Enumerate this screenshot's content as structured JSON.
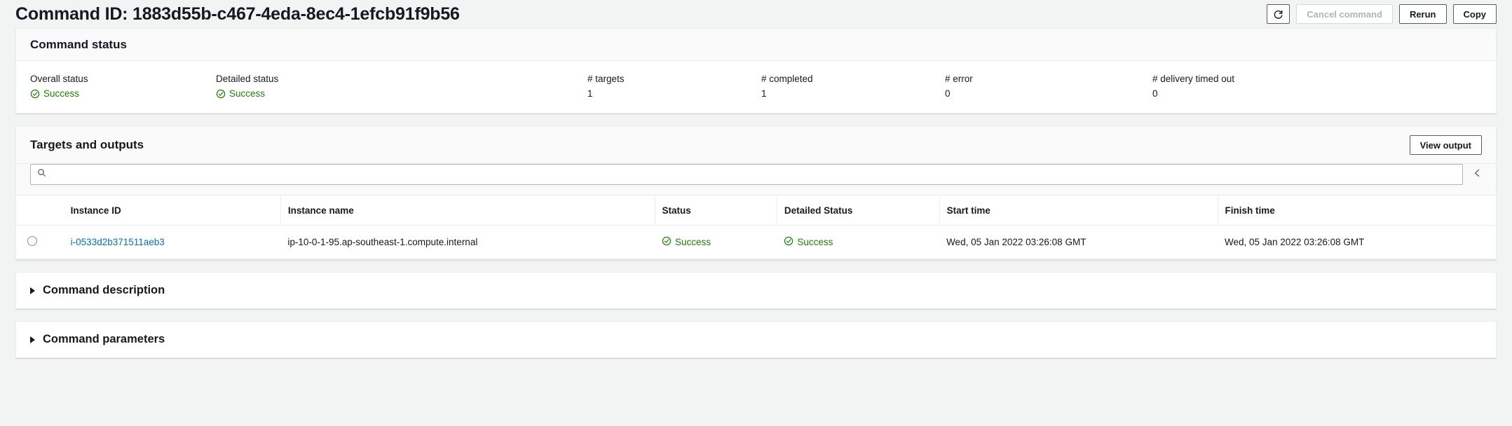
{
  "header": {
    "title": "Command ID: 1883d55b-c467-4eda-8ec4-1efcb91f9b56",
    "refresh_icon": "refresh-icon",
    "cancel_label": "Cancel command",
    "rerun_label": "Rerun",
    "copy_label": "Copy"
  },
  "command_status": {
    "section_title": "Command status",
    "fields": [
      {
        "label": "Overall status",
        "value": "Success",
        "status": true
      },
      {
        "label": "Detailed status",
        "value": "Success",
        "status": true
      },
      {
        "label": "# targets",
        "value": "1",
        "status": false
      },
      {
        "label": "# completed",
        "value": "1",
        "status": false
      },
      {
        "label": "# error",
        "value": "0",
        "status": false
      },
      {
        "label": "# delivery timed out",
        "value": "0",
        "status": false
      }
    ]
  },
  "targets": {
    "section_title": "Targets and outputs",
    "view_output_label": "View output",
    "search": {
      "value": "",
      "placeholder": "",
      "icon": "search-icon"
    },
    "pager_prev_icon": "chevron-left-icon",
    "columns": [
      "Instance ID",
      "Instance name",
      "Status",
      "Detailed Status",
      "Start time",
      "Finish time"
    ],
    "rows": [
      {
        "instance_id": "i-0533d2b371511aeb3",
        "instance_name": "ip-10-0-1-95.ap-southeast-1.compute.internal",
        "status": "Success",
        "detailed_status": "Success",
        "start_time": "Wed, 05 Jan 2022 03:26:08 GMT",
        "finish_time": "Wed, 05 Jan 2022 03:26:08 GMT"
      }
    ]
  },
  "sections": {
    "command_description": "Command description",
    "command_parameters": "Command parameters"
  },
  "colors": {
    "success_green": "#1d8102",
    "link_blue": "#0073bb",
    "page_bg": "#f2f3f3",
    "border": "#eaeded"
  }
}
